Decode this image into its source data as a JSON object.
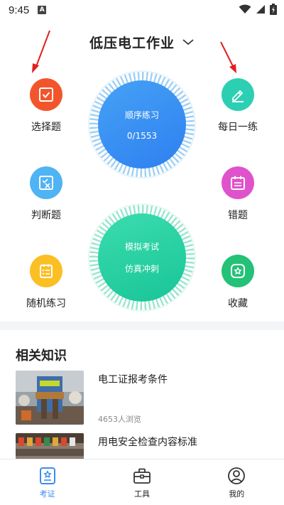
{
  "status_bar": {
    "time": "9:45",
    "notification_letter": "A"
  },
  "header": {
    "title": "低压电工作业"
  },
  "categories": {
    "choice": {
      "label": "选择题",
      "color": "#f2552c"
    },
    "daily": {
      "label": "每日一练",
      "color": "#2dcfb3"
    },
    "judge": {
      "label": "判断题",
      "color": "#4fb3f4"
    },
    "wrong": {
      "label": "错题",
      "color": "#e052cc"
    },
    "random": {
      "label": "随机练习",
      "color": "#fbbf24"
    },
    "favorite": {
      "label": "收藏",
      "color": "#23c277"
    }
  },
  "sequence_practice": {
    "label": "顺序练习",
    "progress": "0/1553"
  },
  "mock_exam": {
    "line1": "模拟考试",
    "line2": "仿真冲刺"
  },
  "knowledge": {
    "title": "相关知识",
    "articles": [
      {
        "title": "电工证报考条件",
        "views": "4653人浏览"
      },
      {
        "title": "用电安全检查内容标准"
      }
    ]
  },
  "bottom_nav": {
    "items": [
      {
        "label": "考证",
        "icon": "certificate-icon",
        "active": true
      },
      {
        "label": "工具",
        "icon": "toolbox-icon"
      },
      {
        "label": "我的",
        "icon": "profile-icon"
      }
    ]
  },
  "colors": {
    "accent": "#3a8df0",
    "arrow": "#e0201f"
  }
}
